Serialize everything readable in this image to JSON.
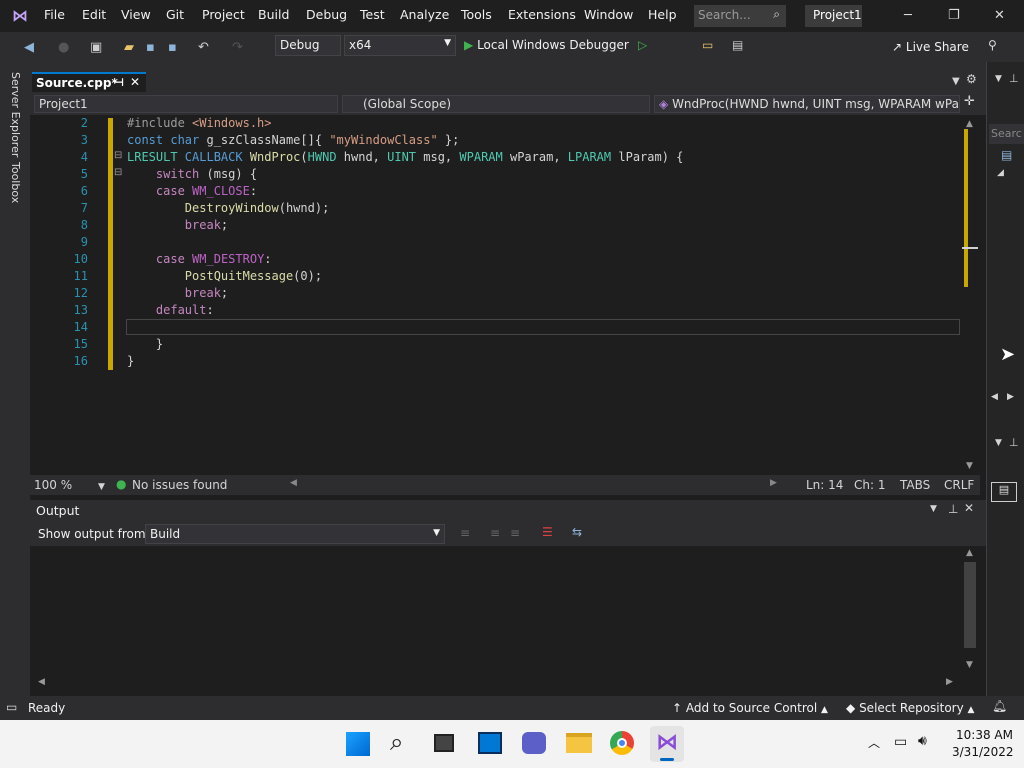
{
  "menu": [
    "File",
    "Edit",
    "View",
    "Git",
    "Project",
    "Build",
    "Debug",
    "Test",
    "Analyze",
    "Tools",
    "Extensions",
    "Window",
    "Help"
  ],
  "search_placeholder": "Search...",
  "project_badge": "Project1",
  "toolbar": {
    "config": "Debug",
    "platform": "x64",
    "run_label": "Local Windows Debugger",
    "live_share": "Live Share"
  },
  "tab": {
    "label": "Source.cpp*"
  },
  "side_tabs": [
    "Server Explorer",
    "Toolbox"
  ],
  "nav": {
    "project": "Project1",
    "scope": "(Global Scope)",
    "member": "WndProc(HWND hwnd, UINT msg, WPARAM wPara"
  },
  "right_search": "Searc",
  "line_numbers": [
    "2",
    "3",
    "4",
    "5",
    "6",
    "7",
    "8",
    "9",
    "10",
    "11",
    "12",
    "13",
    "14",
    "15",
    "16"
  ],
  "editor_status": {
    "zoom": "100 %",
    "issues": "No issues found",
    "ln": "Ln: 14",
    "ch": "Ch: 1",
    "tabs": "TABS",
    "eol": "CRLF"
  },
  "output": {
    "title": "Output",
    "show_label": "Show output from:",
    "source": "Build"
  },
  "statusbar": {
    "ready": "Ready",
    "source_control": "Add to Source Control",
    "repo": "Select Repository"
  },
  "taskbar": {
    "time": "10:38 AM",
    "date": "3/31/2022"
  },
  "colors": {
    "accent": "#007acc",
    "modified_bar": "#c8a800"
  }
}
